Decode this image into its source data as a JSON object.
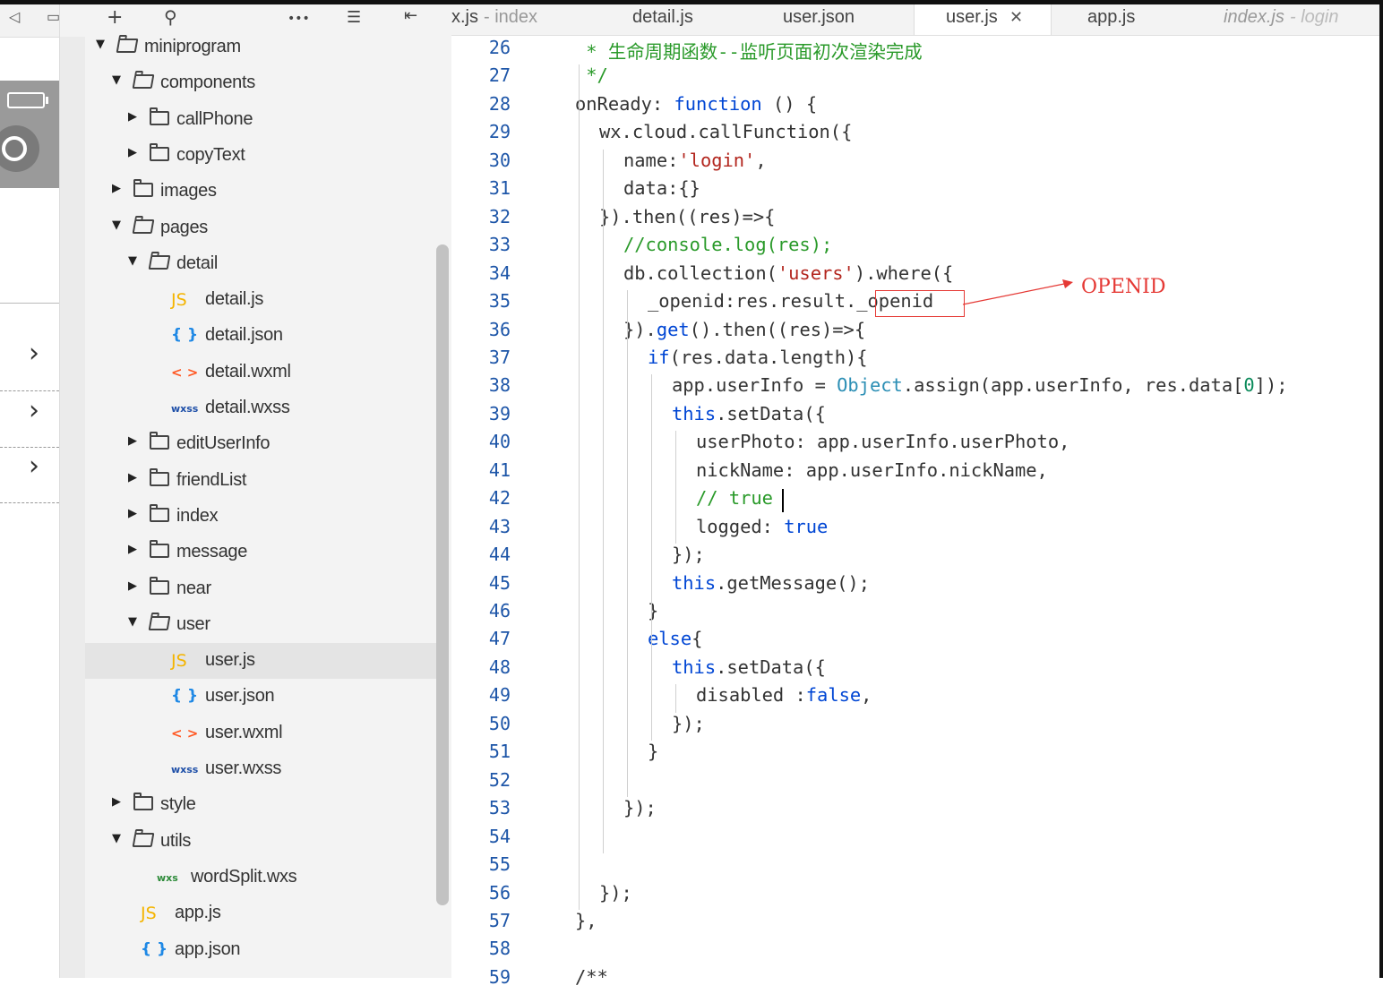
{
  "explorer": {
    "toolbar": {
      "add": "+",
      "search": "search-icon",
      "more": "•••",
      "collapse": "collapse-icon",
      "split": "split-icon"
    },
    "items": [
      {
        "label": "miniprogram",
        "depth": 0,
        "type": "folder",
        "expanded": true
      },
      {
        "label": "components",
        "depth": 1,
        "type": "folder",
        "expanded": true
      },
      {
        "label": "callPhone",
        "depth": 2,
        "type": "folder",
        "expanded": false
      },
      {
        "label": "copyText",
        "depth": 2,
        "type": "folder",
        "expanded": false
      },
      {
        "label": "images",
        "depth": 1,
        "type": "folder",
        "expanded": false
      },
      {
        "label": "pages",
        "depth": 1,
        "type": "folder",
        "expanded": true
      },
      {
        "label": "detail",
        "depth": 2,
        "type": "folder",
        "expanded": true
      },
      {
        "label": "detail.js",
        "depth": 3,
        "type": "js",
        "icon": "JS"
      },
      {
        "label": "detail.json",
        "depth": 3,
        "type": "json",
        "icon": "{ }"
      },
      {
        "label": "detail.wxml",
        "depth": 3,
        "type": "wxml",
        "icon": "< >"
      },
      {
        "label": "detail.wxss",
        "depth": 3,
        "type": "wxss",
        "icon": "wxss"
      },
      {
        "label": "editUserInfo",
        "depth": 2,
        "type": "folder",
        "expanded": false
      },
      {
        "label": "friendList",
        "depth": 2,
        "type": "folder",
        "expanded": false
      },
      {
        "label": "index",
        "depth": 2,
        "type": "folder",
        "expanded": false
      },
      {
        "label": "message",
        "depth": 2,
        "type": "folder",
        "expanded": false
      },
      {
        "label": "near",
        "depth": 2,
        "type": "folder",
        "expanded": false
      },
      {
        "label": "user",
        "depth": 2,
        "type": "folder",
        "expanded": true
      },
      {
        "label": "user.js",
        "depth": 3,
        "type": "js",
        "icon": "JS",
        "selected": true
      },
      {
        "label": "user.json",
        "depth": 3,
        "type": "json",
        "icon": "{ }"
      },
      {
        "label": "user.wxml",
        "depth": 3,
        "type": "wxml",
        "icon": "< >"
      },
      {
        "label": "user.wxss",
        "depth": 3,
        "type": "wxss",
        "icon": "wxss"
      },
      {
        "label": "style",
        "depth": 1,
        "type": "folder",
        "expanded": false
      },
      {
        "label": "utils",
        "depth": 1,
        "type": "folder",
        "expanded": true
      },
      {
        "label": "wordSplit.wxs",
        "depth": 2,
        "type": "wxs",
        "icon": "wxs"
      },
      {
        "label": "app.js",
        "depth": 1,
        "type": "js",
        "icon": "JS"
      },
      {
        "label": "app.json",
        "depth": 1,
        "type": "json",
        "icon": "{ }"
      }
    ]
  },
  "tabs": [
    {
      "name": "x.js",
      "hint": " - index"
    },
    {
      "name": "detail.js",
      "hint": ""
    },
    {
      "name": "user.json",
      "hint": ""
    },
    {
      "name": "user.js",
      "hint": "",
      "active": true,
      "close": "✕"
    },
    {
      "name": "app.js",
      "hint": ""
    },
    {
      "name": "index.js",
      "hint": " - login",
      "italic": true
    }
  ],
  "editor": {
    "lines": [
      {
        "n": "26",
        "indent": 0,
        "tokens": [
          [
            "c",
            " * 生命周期函数--监听页面初次渲染完成"
          ]
        ]
      },
      {
        "n": "27",
        "indent": 0,
        "tokens": [
          [
            "c",
            " */"
          ]
        ]
      },
      {
        "n": "28",
        "indent": 0,
        "tokens": [
          [
            "p",
            "onReady: "
          ],
          [
            "k",
            "function"
          ],
          [
            "p",
            " () {"
          ]
        ]
      },
      {
        "n": "29",
        "indent": 1,
        "tokens": [
          [
            "p",
            "wx.cloud.callFunction({"
          ]
        ]
      },
      {
        "n": "30",
        "indent": 2,
        "tokens": [
          [
            "p",
            "name:"
          ],
          [
            "s",
            "'login'"
          ],
          [
            "p",
            ","
          ]
        ]
      },
      {
        "n": "31",
        "indent": 2,
        "tokens": [
          [
            "p",
            "data:{}"
          ]
        ]
      },
      {
        "n": "32",
        "indent": 1,
        "tokens": [
          [
            "p",
            "}).then((res)=>{"
          ]
        ]
      },
      {
        "n": "33",
        "indent": 2,
        "tokens": [
          [
            "c",
            "//console.log(res);"
          ]
        ]
      },
      {
        "n": "34",
        "indent": 2,
        "tokens": [
          [
            "p",
            "db.collection("
          ],
          [
            "s",
            "'users'"
          ],
          [
            "p",
            ").where({"
          ]
        ]
      },
      {
        "n": "35",
        "indent": 3,
        "tokens": [
          [
            "p",
            "_openid:res.result._openid"
          ]
        ]
      },
      {
        "n": "36",
        "indent": 2,
        "tokens": [
          [
            "p",
            "})."
          ],
          [
            "k",
            "get"
          ],
          [
            "p",
            "().then((res)=>{"
          ]
        ]
      },
      {
        "n": "37",
        "indent": 3,
        "tokens": [
          [
            "k",
            "if"
          ],
          [
            "p",
            "(res.data.length){"
          ]
        ]
      },
      {
        "n": "38",
        "indent": 4,
        "tokens": [
          [
            "p",
            "app.userInfo = "
          ],
          [
            "o",
            "Object"
          ],
          [
            "p",
            ".assign(app.userInfo, res.data["
          ],
          [
            "n",
            "0"
          ],
          [
            "p",
            "]);"
          ]
        ]
      },
      {
        "n": "39",
        "indent": 4,
        "tokens": [
          [
            "k",
            "this"
          ],
          [
            "p",
            ".setData({"
          ]
        ]
      },
      {
        "n": "40",
        "indent": 5,
        "tokens": [
          [
            "p",
            "userPhoto: app.userInfo.userPhoto,"
          ]
        ]
      },
      {
        "n": "41",
        "indent": 5,
        "tokens": [
          [
            "p",
            "nickName: app.userInfo.nickName,"
          ]
        ]
      },
      {
        "n": "42",
        "indent": 5,
        "tokens": [
          [
            "c",
            "// true"
          ]
        ]
      },
      {
        "n": "43",
        "indent": 5,
        "tokens": [
          [
            "p",
            "logged: "
          ],
          [
            "k",
            "true"
          ]
        ]
      },
      {
        "n": "44",
        "indent": 4,
        "tokens": [
          [
            "p",
            "});"
          ]
        ]
      },
      {
        "n": "45",
        "indent": 4,
        "tokens": [
          [
            "k",
            "this"
          ],
          [
            "p",
            ".getMessage();"
          ]
        ]
      },
      {
        "n": "46",
        "indent": 3,
        "tokens": [
          [
            "p",
            "}"
          ]
        ]
      },
      {
        "n": "47",
        "indent": 3,
        "tokens": [
          [
            "k",
            "else"
          ],
          [
            "p",
            "{"
          ]
        ]
      },
      {
        "n": "48",
        "indent": 4,
        "tokens": [
          [
            "k",
            "this"
          ],
          [
            "p",
            ".setData({"
          ]
        ]
      },
      {
        "n": "49",
        "indent": 5,
        "tokens": [
          [
            "p",
            "disabled :"
          ],
          [
            "k",
            "false"
          ],
          [
            "p",
            ","
          ]
        ]
      },
      {
        "n": "50",
        "indent": 4,
        "tokens": [
          [
            "p",
            "});"
          ]
        ]
      },
      {
        "n": "51",
        "indent": 3,
        "tokens": [
          [
            "p",
            "}"
          ]
        ]
      },
      {
        "n": "52",
        "indent": 0,
        "tokens": []
      },
      {
        "n": "53",
        "indent": 2,
        "tokens": [
          [
            "p",
            "});"
          ]
        ]
      },
      {
        "n": "54",
        "indent": 0,
        "tokens": []
      },
      {
        "n": "55",
        "indent": 0,
        "tokens": []
      },
      {
        "n": "56",
        "indent": 1,
        "tokens": [
          [
            "p",
            "});"
          ]
        ]
      },
      {
        "n": "57",
        "indent": 0,
        "tokens": [
          [
            "p",
            "},"
          ]
        ]
      },
      {
        "n": "58",
        "indent": 0,
        "tokens": []
      },
      {
        "n": "59",
        "indent": 0,
        "tokens": [
          [
            "p",
            "/**"
          ]
        ]
      }
    ]
  },
  "annotation": {
    "label": "OPENID",
    "color": "#e53935"
  },
  "colors": {
    "keyword": "#0046d4",
    "string": "#b3261e",
    "comment": "#2a9a2a",
    "lineNumber": "#1e56a8"
  }
}
